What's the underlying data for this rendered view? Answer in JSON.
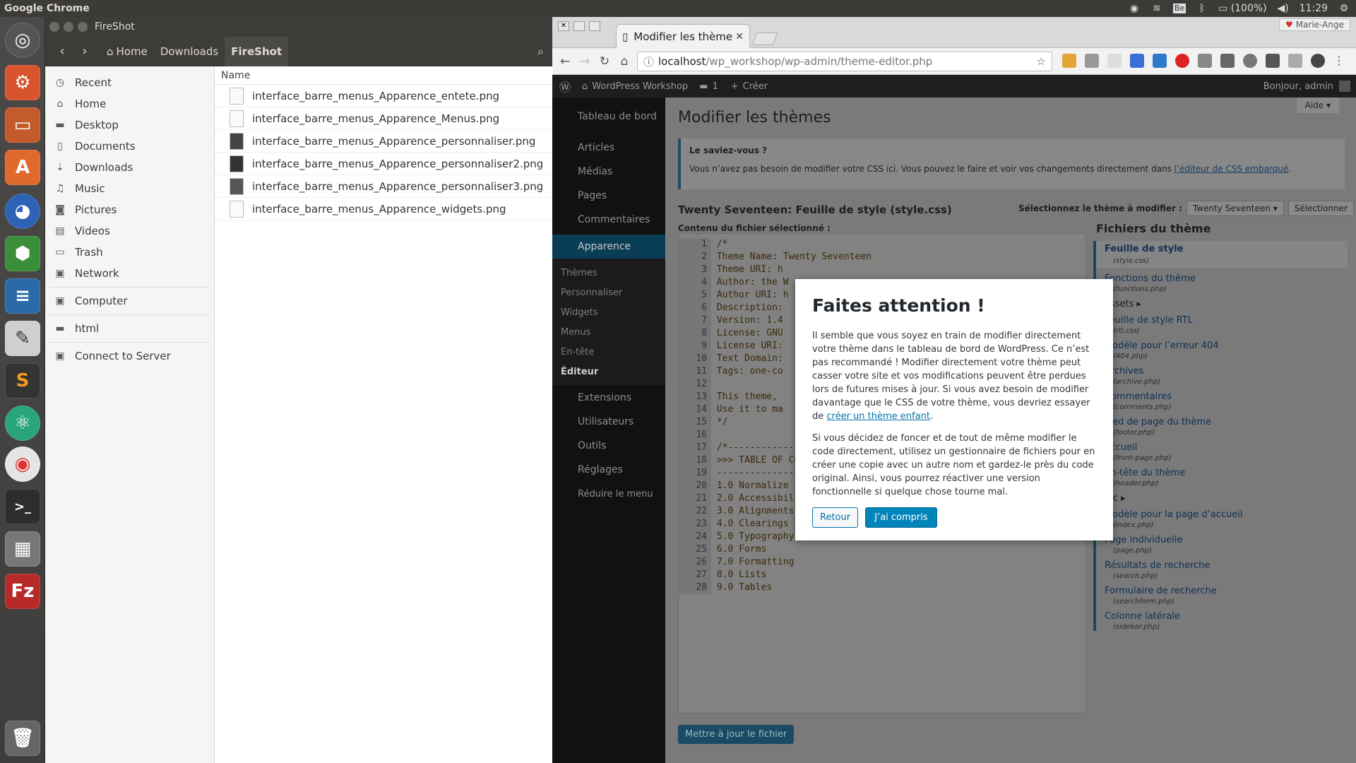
{
  "topbar": {
    "app_title": "Google Chrome",
    "battery": "(100%)",
    "clock": "11:29"
  },
  "launcher": {
    "items": [
      "ubuntu-dash-icon",
      "settings-icon",
      "files-icon",
      "software-center-icon",
      "firefox-icon",
      "cube-icon",
      "writer-icon",
      "text-editor-icon",
      "sublime-icon",
      "atom-icon",
      "chrome-icon",
      "terminal-icon",
      "calculator-icon",
      "filezilla-icon",
      "trash-icon"
    ]
  },
  "files_window": {
    "title": "FireShot",
    "crumbs": [
      "Home",
      "Downloads",
      "FireShot"
    ],
    "sidebar": [
      "Recent",
      "Home",
      "Desktop",
      "Documents",
      "Downloads",
      "Music",
      "Pictures",
      "Videos",
      "Trash",
      "Network",
      "Computer",
      "html",
      "Connect to Server"
    ],
    "column": "Name",
    "files": [
      "interface_barre_menus_Apparence_entete.png",
      "interface_barre_menus_Apparence_Menus.png",
      "interface_barre_menus_Apparence_personnaliser.png",
      "interface_barre_menus_Apparence_personnaliser2.png",
      "interface_barre_menus_Apparence_personnaliser3.png",
      "interface_barre_menus_Apparence_widgets.png"
    ]
  },
  "chrome": {
    "tab_title": "Modifier les thème",
    "url_host": "localhost",
    "url_path": "/wp_workshop/wp-admin/theme-editor.php",
    "profile": "Marie-Ange"
  },
  "wp": {
    "site_name": "WordPress Workshop",
    "comments_count": "1",
    "new_label": "Créer",
    "greeting": "Bonjour, admin",
    "help": "Aide",
    "page_title": "Modifier les thèmes",
    "notice_title": "Le saviez-vous ?",
    "notice_text": "Vous n’avez pas besoin de modifier votre CSS ici. Vous pouvez le faire et voir vos changements directement dans ",
    "notice_link": "l’éditeur de CSS embarqué",
    "notice_end": ".",
    "file_heading": "Twenty Seventeen: Feuille de style (style.css)",
    "select_label": "Sélectionnez le thème à modifier :",
    "select_value": "Twenty Seventeen",
    "select_button": "Sélectionner",
    "content_label": "Contenu du fichier sélectionné :",
    "theme_files_title": "Fichiers du thème",
    "update_button": "Mettre à jour le fichier",
    "menu": [
      "Tableau de bord",
      "Articles",
      "Médias",
      "Pages",
      "Commentaires",
      "Apparence",
      "Extensions",
      "Utilisateurs",
      "Outils",
      "Réglages",
      "Réduire le menu"
    ],
    "submenu": [
      "Thèmes",
      "Personnaliser",
      "Widgets",
      "Menus",
      "En-tête",
      "Éditeur"
    ],
    "code": [
      "/*",
      "Theme Name: Twenty Seventeen",
      "Theme URI: h",
      "Author: the W",
      "Author URI: h",
      "Description:",
      "Version: 1.4",
      "License: GNU",
      "License URI:",
      "Text Domain:",
      "Tags: one-co",
      "",
      "This theme,",
      "Use it to ma",
      "*/",
      "",
      "/*--------------------------------------------------------------",
      ">>> TABLE OF CONTENTS:",
      "----------------------------------------------------------------",
      "1.0 Normalize",
      "2.0 Accessibility",
      "3.0 Alignments",
      "4.0 Clearings",
      "5.0 Typography",
      "6.0 Forms",
      "7.0 Formatting",
      "8.0 Lists",
      "9.0 Tables"
    ],
    "theme_files": [
      {
        "name": "Feuille de style",
        "file": "(style.css)"
      },
      {
        "name": "Fonctions du thème",
        "file": "(functions.php)"
      },
      {
        "name": "assets ▸",
        "file": ""
      },
      {
        "name": "Feuille de style RTL",
        "file": "(rtl.css)"
      },
      {
        "name": "Modèle pour l’erreur 404",
        "file": "(404.php)"
      },
      {
        "name": "Archives",
        "file": "(archive.php)"
      },
      {
        "name": "Commentaires",
        "file": "(comments.php)"
      },
      {
        "name": "Pied de page du thème",
        "file": "(footer.php)"
      },
      {
        "name": "Accueil",
        "file": "(front-page.php)"
      },
      {
        "name": "En-tête du thème",
        "file": "(header.php)"
      },
      {
        "name": "inc ▸",
        "file": ""
      },
      {
        "name": "Modèle pour la page d’accueil",
        "file": "(index.php)"
      },
      {
        "name": "Page individuelle",
        "file": "(page.php)"
      },
      {
        "name": "Résultats de recherche",
        "file": "(search.php)"
      },
      {
        "name": "Formulaire de recherche",
        "file": "(searchform.php)"
      },
      {
        "name": "Colonne latérale",
        "file": "(sidebar.php)"
      }
    ]
  },
  "modal": {
    "title": "Faites attention !",
    "p1": "Il semble que vous soyez en train de modifier directement votre thème dans le tableau de bord de WordPress. Ce n’est pas recommandé ! Modifier directement votre thème peut casser votre site et vos modifications peuvent être perdues lors de futures mises à jour. Si vous avez besoin de modifier davantage que le CSS de votre thème, vous devriez essayer de ",
    "p1_link": "créer un thème enfant",
    "p1_end": ".",
    "p2": "Si vous décidez de foncer et de tout de même modifier le code directement, utilisez un gestionnaire de fichiers pour en créer une copie avec un autre nom et gardez-le près du code original. Ainsi, vous pourrez réactiver une version fonctionnelle si quelque chose tourne mal.",
    "back": "Retour",
    "ok": "J’ai compris"
  }
}
